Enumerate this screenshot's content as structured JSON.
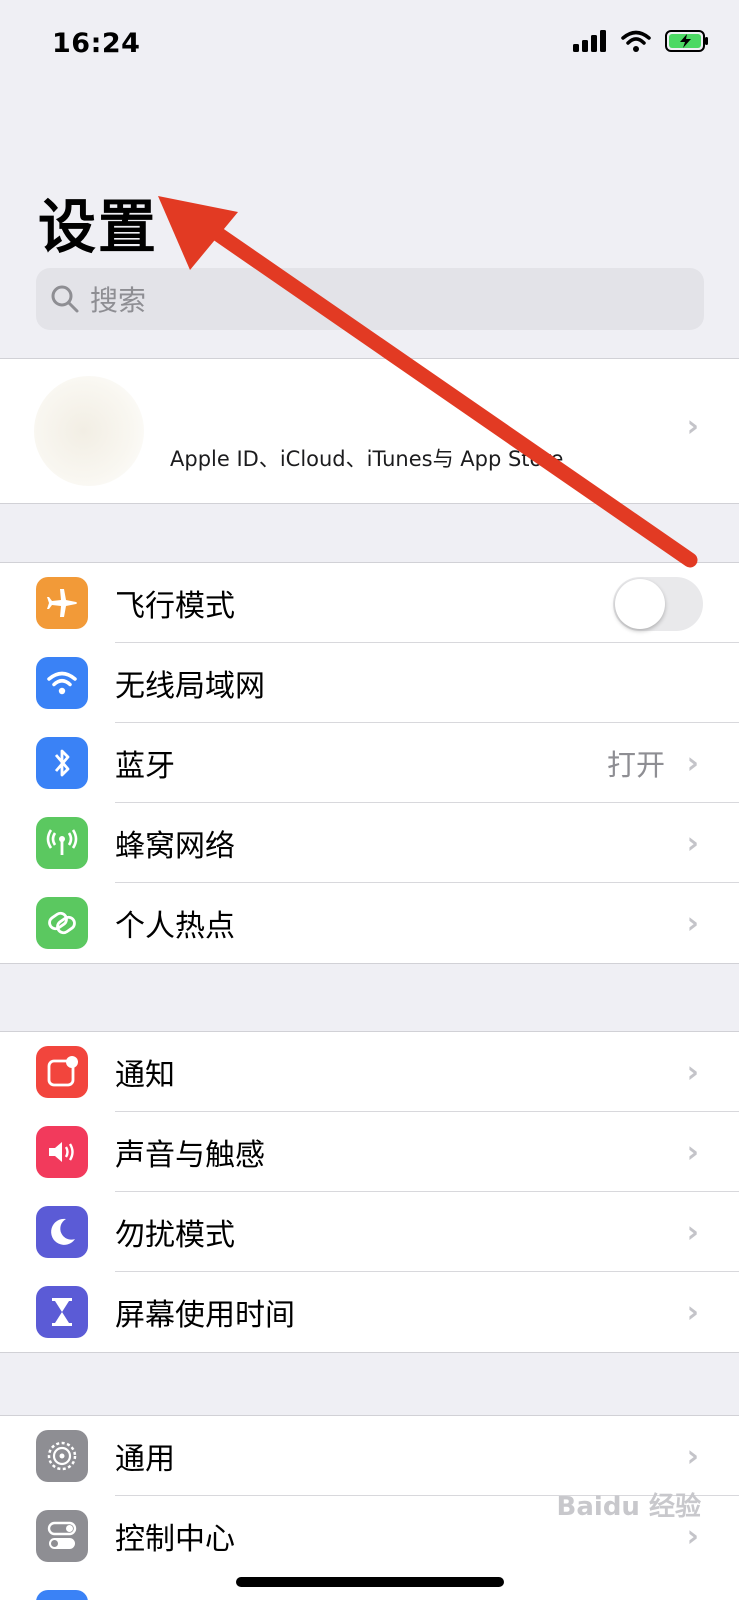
{
  "status_bar": {
    "time": "16:24"
  },
  "title": "设置",
  "search": {
    "placeholder": "搜索"
  },
  "profile": {
    "subtitle": "Apple ID、iCloud、iTunes与 App Store"
  },
  "group1": [
    {
      "label": "飞行模式",
      "icon": "airplane-icon",
      "color": "#f29a38",
      "control": "toggle",
      "toggle_on": false
    },
    {
      "label": "无线局域网",
      "icon": "wifi-icon",
      "color": "#3a82f6",
      "control": "none"
    },
    {
      "label": "蓝牙",
      "icon": "bluetooth-icon",
      "color": "#3a82f6",
      "control": "chevron",
      "value": "打开"
    },
    {
      "label": "蜂窝网络",
      "icon": "cellular-icon",
      "color": "#5bc860",
      "control": "chevron"
    },
    {
      "label": "个人热点",
      "icon": "hotspot-icon",
      "color": "#5bc860",
      "control": "chevron"
    }
  ],
  "group2": [
    {
      "label": "通知",
      "icon": "notifications-icon",
      "color": "#f2453d",
      "control": "chevron"
    },
    {
      "label": "声音与触感",
      "icon": "sound-icon",
      "color": "#f23a5c",
      "control": "chevron"
    },
    {
      "label": "勿扰模式",
      "icon": "moon-icon",
      "color": "#5b5bd6",
      "control": "chevron"
    },
    {
      "label": "屏幕使用时间",
      "icon": "hourglass-icon",
      "color": "#5b5bd6",
      "control": "chevron"
    }
  ],
  "group3": [
    {
      "label": "通用",
      "icon": "gear-icon",
      "color": "#8e8e93",
      "control": "chevron"
    },
    {
      "label": "控制中心",
      "icon": "control-center-icon",
      "color": "#8e8e93",
      "control": "chevron"
    }
  ],
  "watermark": "Baidu 经验",
  "colors": {
    "arrow": "#e23a23",
    "background": "#efeff4"
  }
}
